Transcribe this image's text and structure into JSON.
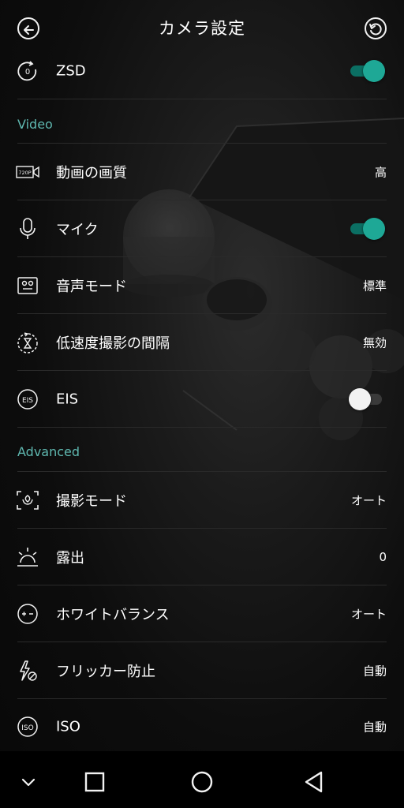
{
  "header": {
    "title": "カメラ設定"
  },
  "rows_top": {
    "zsd": {
      "label": "ZSD",
      "enabled": true
    }
  },
  "sections": {
    "video": "Video",
    "advanced": "Advanced"
  },
  "video": {
    "quality": {
      "label": "動画の画質",
      "value": "高"
    },
    "mic": {
      "label": "マイク",
      "enabled": true
    },
    "audio_mode": {
      "label": "音声モード",
      "value": "標準"
    },
    "timelapse": {
      "label": "低速度撮影の間隔",
      "value": "無効"
    },
    "eis": {
      "label": "EIS",
      "enabled": false
    }
  },
  "advanced": {
    "shooting_mode": {
      "label": "撮影モード",
      "value": "オート"
    },
    "exposure": {
      "label": "露出",
      "value": "0"
    },
    "white_balance": {
      "label": "ホワイトバランス",
      "value": "オート"
    },
    "anti_flicker": {
      "label": "フリッカー防止",
      "value": "自動"
    },
    "iso": {
      "label": "ISO",
      "value": "自動"
    }
  },
  "icons": {
    "back": "back-arrow-icon",
    "reset": "reset-icon",
    "zsd": "zsd-icon",
    "quality": "video-720p-icon",
    "mic": "microphone-icon",
    "audio_mode": "audio-mode-icon",
    "timelapse": "timelapse-icon",
    "eis": "eis-icon",
    "shooting_mode": "scene-mode-icon",
    "exposure": "exposure-icon",
    "white_balance": "white-balance-icon",
    "anti_flicker": "anti-flicker-icon",
    "iso": "iso-icon"
  },
  "colors": {
    "accent": "#5fb8b0",
    "toggle_on": "#1ea896",
    "toggle_off_thumb": "#f2f2f2",
    "background": "#0b0b0b"
  }
}
